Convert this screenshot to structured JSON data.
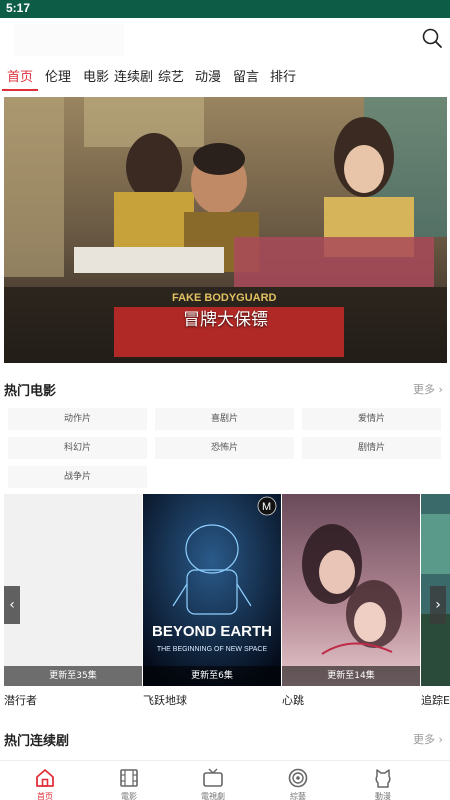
{
  "status_bar": {
    "time": "5:17"
  },
  "colors": {
    "accent": "#e0303a",
    "status_bar": "#0d5c46"
  },
  "nav": {
    "tabs": [
      {
        "label": "首页",
        "active": true
      },
      {
        "label": "伦理"
      },
      {
        "label": "电影"
      },
      {
        "label": "连续剧"
      },
      {
        "label": "综艺"
      },
      {
        "label": "动漫"
      },
      {
        "label": "留言"
      },
      {
        "label": "排行"
      }
    ]
  },
  "banner": {
    "caption": "冒牌大保镖",
    "poster_text": "FAKE BODYGUARD"
  },
  "hot_movies": {
    "title": "热门电影",
    "more": "更多",
    "genres": [
      "动作片",
      "喜剧片",
      "爱情片",
      "科幻片",
      "恐怖片",
      "剧情片",
      "战争片"
    ],
    "cards": [
      {
        "title": "潜行者",
        "badge": "更新至35集"
      },
      {
        "title": "飞跃地球",
        "badge": "更新至6集",
        "poster_line1": "BEYOND EARTH",
        "poster_line2": "THE BEGINNING OF NEW SPACE"
      },
      {
        "title": "心跳",
        "badge": "更新至14集"
      },
      {
        "title": "追踪E"
      }
    ]
  },
  "hot_series": {
    "title": "热门连续剧",
    "more": "更多"
  },
  "bottom_nav": [
    {
      "label": "首页",
      "icon": "home-icon",
      "active": true
    },
    {
      "label": "電影",
      "icon": "film-icon"
    },
    {
      "label": "電視劇",
      "icon": "tv-icon"
    },
    {
      "label": "綜藝",
      "icon": "variety-icon"
    },
    {
      "label": "動漫",
      "icon": "anime-icon"
    }
  ]
}
